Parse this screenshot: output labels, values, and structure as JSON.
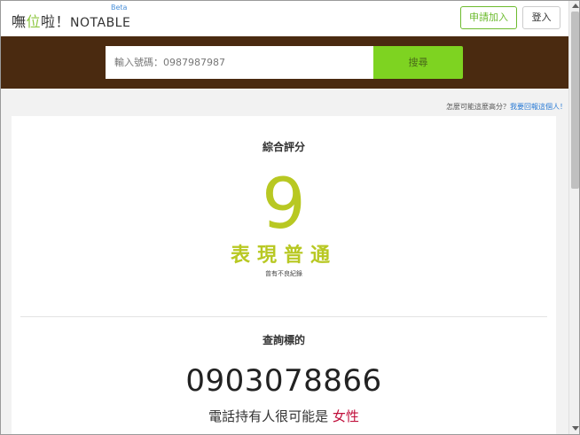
{
  "header": {
    "logo_part1": "嘸",
    "logo_accent": "位",
    "logo_part2": "啦！",
    "logo_latin": "NOTABLE",
    "beta": "Beta",
    "apply_label": "申請加入",
    "login_label": "登入"
  },
  "search": {
    "placeholder": "輸入號碼：0987987987",
    "button_label": "搜尋"
  },
  "helper": {
    "question": "怎麼可能這麼高分？",
    "link": "我要回報這個人！"
  },
  "score": {
    "title": "綜合評分",
    "value": "9",
    "label": "表現普通",
    "note": "曾有不良紀錄"
  },
  "target": {
    "title": "查詢標的",
    "phone": "0903078866",
    "owner_prefix": "電話持有人很可能是 ",
    "owner_gender": "女性"
  },
  "colors": {
    "brand_green": "#7ed321",
    "band_brown": "#4a2a10",
    "score_color": "#b8c822",
    "gender_color": "#c0103c",
    "link_blue": "#2a7bd5"
  }
}
